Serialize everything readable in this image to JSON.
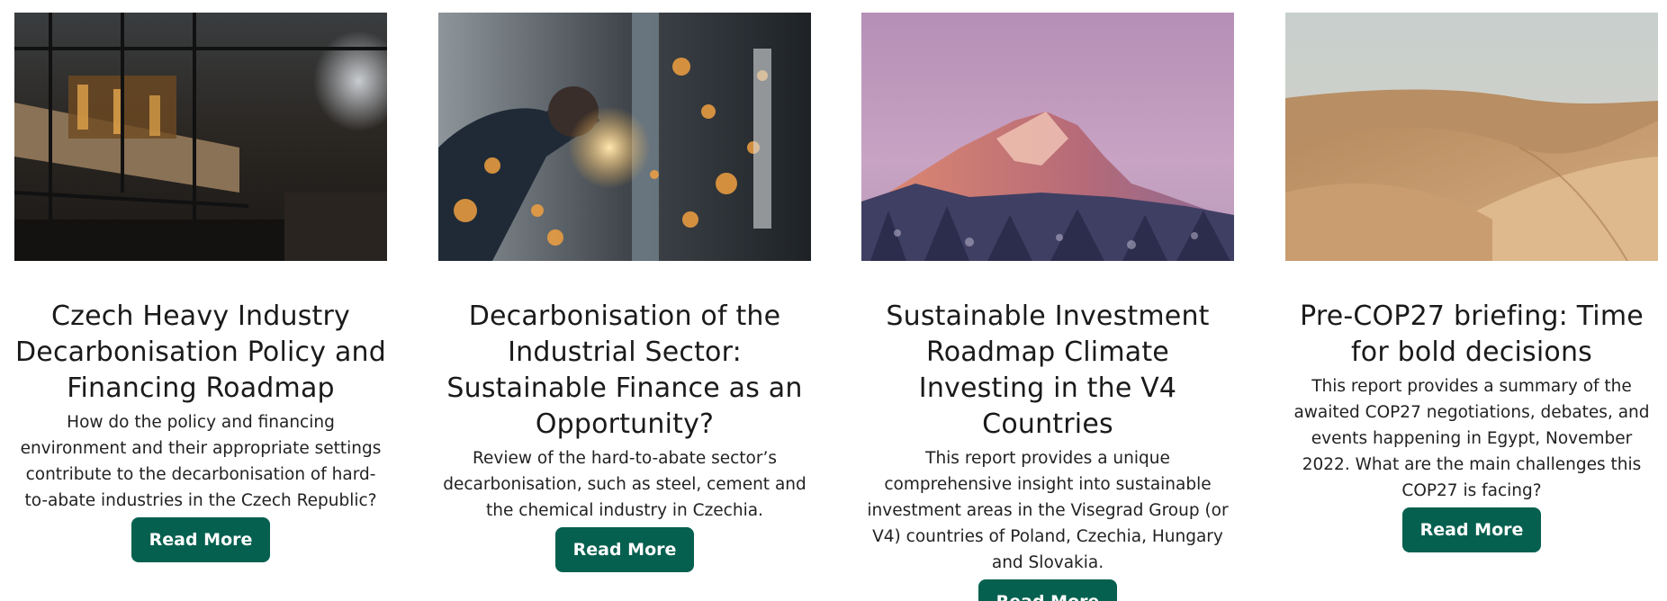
{
  "cards": [
    {
      "image": "steel-factory-interior-image",
      "title": "Czech Heavy Industry Decarbonisation Policy and Financing Roadmap",
      "description": "How do the policy and financing environment and their appropriate settings contribute to the decarbonisation of hard-to-abate industries in the Czech Republic?",
      "button": "Read More"
    },
    {
      "image": "welding-sparks-image",
      "title": "Decarbonisation of the Industrial Sector: Sustainable Finance as an Opportunity?",
      "description": "Review of the hard-to-abate sector’s decarbonisation, such as steel, cement and the chemical industry in Czechia.",
      "button": "Read More"
    },
    {
      "image": "snowy-mountain-peak-image",
      "title": "Sustainable Investment Roadmap Climate Investing in the V4 Countries",
      "description": "This report provides a unique comprehensive insight into sustainable investment areas in the Visegrad Group (or V4) countries of Poland, Czechia, Hungary and Slovakia.",
      "button": "Read More"
    },
    {
      "image": "desert-dunes-image",
      "title": "Pre-COP27 briefing: Time for bold decisions",
      "description": "This report provides a summary of the awaited COP27 negotiations, debates, and events happening in Egypt, November 2022. What are the main challenges this COP27 is facing?",
      "button": "Read More"
    }
  ],
  "colors": {
    "button_bg": "#06604f",
    "button_text": "#ffffff"
  }
}
